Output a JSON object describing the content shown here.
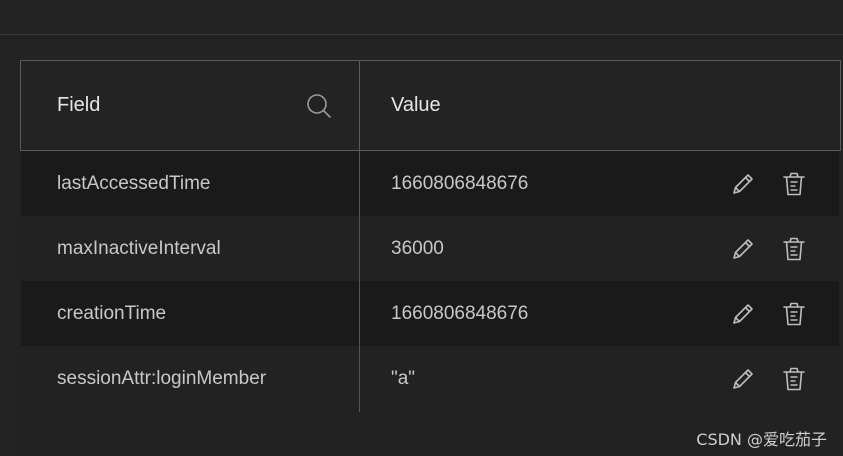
{
  "table": {
    "columns": {
      "field": "Field",
      "value": "Value"
    },
    "rows": [
      {
        "field": "lastAccessedTime",
        "value": "1660806848676"
      },
      {
        "field": "maxInactiveInterval",
        "value": "36000"
      },
      {
        "field": "creationTime",
        "value": "1660806848676"
      },
      {
        "field": "sessionAttr:loginMember",
        "value": "\"a\""
      }
    ],
    "icons": {
      "search": "search-icon",
      "edit": "pencil-icon",
      "delete": "trash-icon"
    }
  },
  "watermark": "CSDN @爱吃茄子",
  "colors": {
    "background": "#232323",
    "row_dark": "#1a1a1a",
    "row_light": "#222222",
    "border": "#5a5a5a",
    "text": "#c8c8c8"
  }
}
